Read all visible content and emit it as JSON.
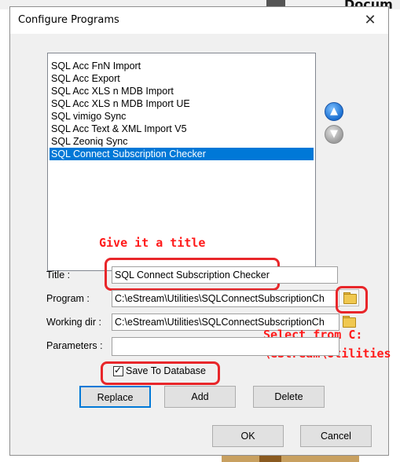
{
  "background": {
    "doc_text": "Docum"
  },
  "window": {
    "title": "Configure Programs",
    "close_glyph": "✕"
  },
  "programs": {
    "items": [
      "SQL Acc FnN Import",
      "SQL Acc Export",
      "SQL Acc XLS n MDB Import",
      "SQL Acc XLS n MDB Import UE",
      "SQL vimigo Sync",
      "SQL Acc Text & XML Import V5",
      "SQL Zeoniq Sync",
      "SQL Connect Subscription Checker"
    ],
    "selected_index": 7
  },
  "move_buttons": {
    "up_glyph": "▲",
    "down_glyph": "▼"
  },
  "annotations": {
    "title_hint": "Give it a title",
    "select_hint_line1": "Select from C:",
    "select_hint_line2": "\\eStream\\Utilities"
  },
  "form": {
    "title_label": "Title :",
    "title_value": "SQL Connect Subscription Checker",
    "program_label": "Program :",
    "program_value": "C:\\eStream\\Utilities\\SQLConnectSubscriptionCh",
    "workdir_label": "Working dir :",
    "workdir_value": "C:\\eStream\\Utilities\\SQLConnectSubscriptionCh",
    "parameters_label": "Parameters :",
    "parameters_value": "",
    "save_to_db_label": "Save To Database",
    "save_to_db_checked": true,
    "check_glyph": "✓"
  },
  "buttons": {
    "replace": "Replace",
    "add": "Add",
    "delete": "Delete",
    "ok": "OK",
    "cancel": "Cancel"
  },
  "colors": {
    "selection": "#0078d7",
    "annotation": "#ff1a1a",
    "highlight_box": "#e8262a"
  }
}
